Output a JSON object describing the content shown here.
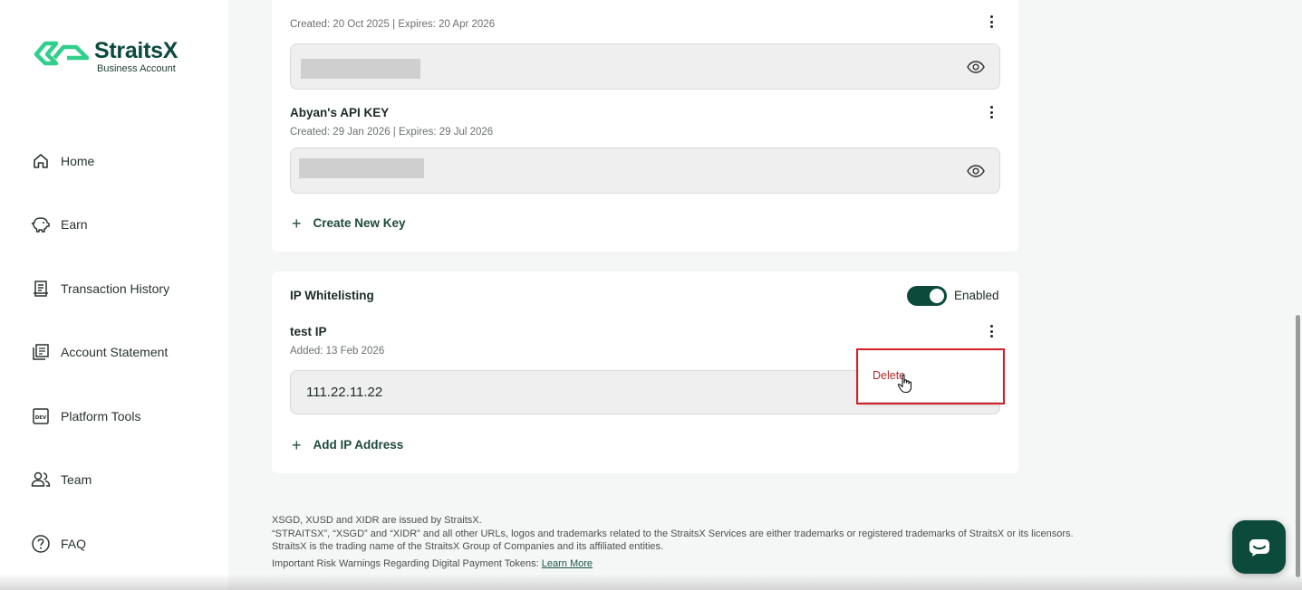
{
  "brand": {
    "name": "StraitsX",
    "subtitle": "Business Account",
    "color": "#0b4a3d",
    "accent": "#2fcf8c"
  },
  "sidebar": {
    "items": [
      {
        "label": "Home",
        "icon": "home-icon"
      },
      {
        "label": "Earn",
        "icon": "piggy-bank-icon"
      },
      {
        "label": "Transaction History",
        "icon": "receipt-icon"
      },
      {
        "label": "Account Statement",
        "icon": "document-list-icon"
      },
      {
        "label": "Platform Tools",
        "icon": "dev-icon"
      },
      {
        "label": "Team",
        "icon": "users-icon"
      },
      {
        "label": "FAQ",
        "icon": "question-icon"
      }
    ]
  },
  "api_keys": {
    "first_key": {
      "meta": "Created: 20 Oct 2025 | Expires: 20 Apr 2026"
    },
    "second_key": {
      "name": "Abyan's API KEY",
      "meta": "Created: 29 Jan 2026 | Expires: 29 Jul 2026"
    },
    "create_label": "Create New Key"
  },
  "ip_whitelisting": {
    "title": "IP Whitelisting",
    "toggle_label": "Enabled",
    "toggle_on": true,
    "entry": {
      "name": "test IP",
      "meta": "Added: 13 Feb 2026",
      "address": "111.22.11.22"
    },
    "add_label": "Add IP Address",
    "menu": {
      "delete_label": "Delete"
    }
  },
  "footer": {
    "line1": "XSGD, XUSD and XIDR are issued by StraitsX.",
    "line2": "“STRAITSX”, “XSGD” and “XIDR” and all other URLs, logos and trademarks related to the StraitsX Services are either trademarks or registered trademarks of StraitsX or its licensors.",
    "line3": "StraitsX is the trading name of the StraitsX Group of Companies and its affiliated entities.",
    "line4": "Important Risk Warnings Regarding Digital Payment Tokens:",
    "link": "Learn More"
  },
  "colors": {
    "primary_dark": "#0c4a3c",
    "danger": "#b12a2a",
    "highlight_box": "#d42127"
  }
}
